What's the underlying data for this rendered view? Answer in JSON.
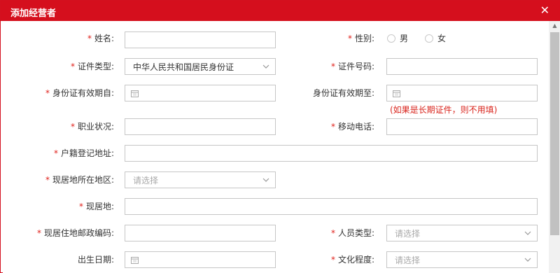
{
  "dialog": {
    "title": "添加经营者",
    "close_icon": "close-icon"
  },
  "form": {
    "name": {
      "label": "姓名:",
      "value": ""
    },
    "gender": {
      "label": "性别:",
      "options": [
        "男",
        "女"
      ]
    },
    "id_type": {
      "label": "证件类型:",
      "value": "中华人民共和国居民身份证"
    },
    "id_number": {
      "label": "证件号码:",
      "value": ""
    },
    "id_valid_from": {
      "label": "身份证有效期自:",
      "value": ""
    },
    "id_valid_to": {
      "label": "身份证有效期至:",
      "value": "",
      "hint": "(如果是长期证件，则不用填)"
    },
    "occupation": {
      "label": "职业状况:",
      "value": ""
    },
    "mobile": {
      "label": "移动电话:",
      "value": ""
    },
    "household_address": {
      "label": "户籍登记地址:",
      "value": ""
    },
    "residence_region": {
      "label": "现居地所在地区:",
      "placeholder": "请选择"
    },
    "residence": {
      "label": "现居地:",
      "value": ""
    },
    "postal_code": {
      "label": "现居住地邮政编码:",
      "value": ""
    },
    "person_type": {
      "label": "人员类型:",
      "placeholder": "请选择"
    },
    "birth_date": {
      "label": "出生日期:",
      "value": ""
    },
    "education": {
      "label": "文化程度:",
      "placeholder": "请选择"
    },
    "required_mark": "*"
  },
  "colors": {
    "header": "#d50f1d",
    "required": "#e0211b",
    "hint": "#d9241c"
  }
}
